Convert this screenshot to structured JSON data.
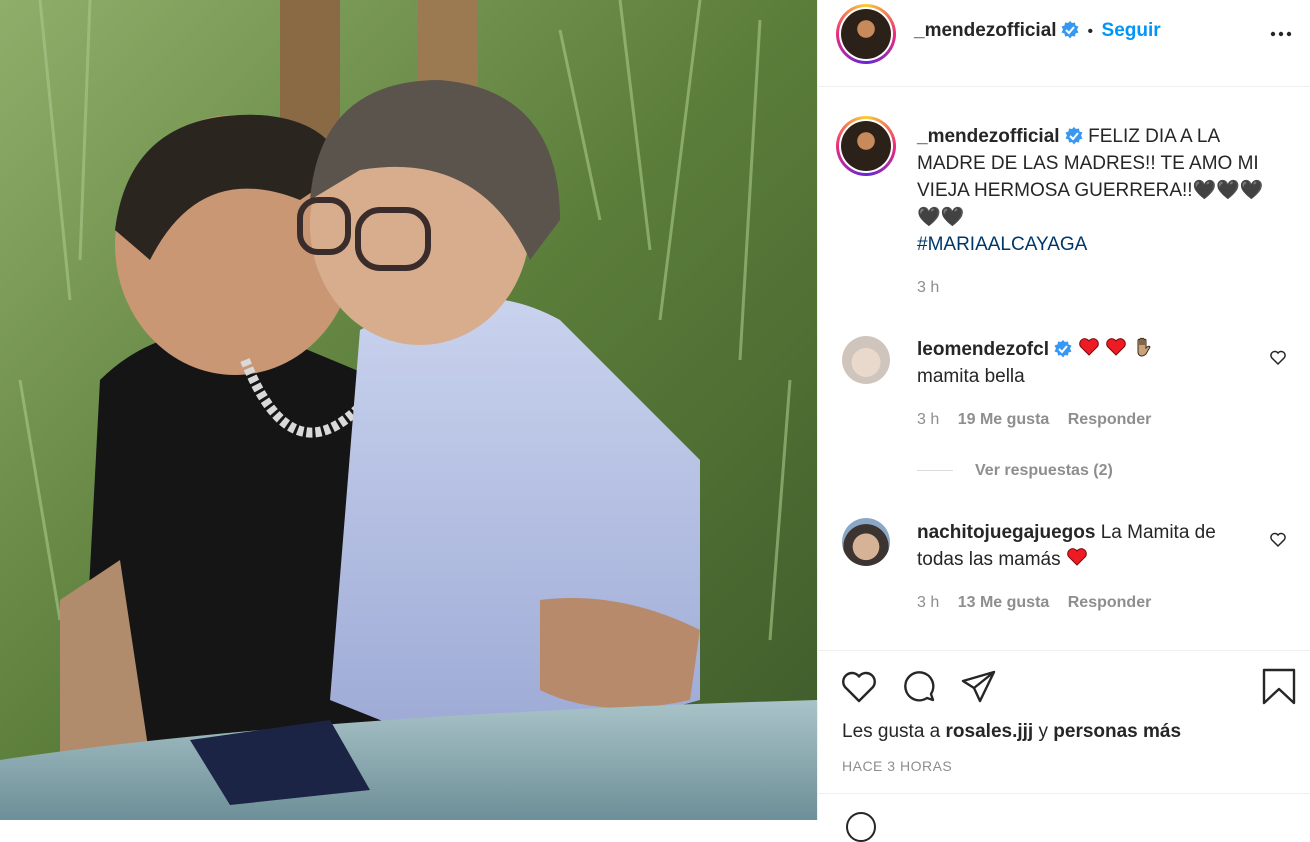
{
  "header": {
    "username": "_mendezofficial",
    "separator": "•",
    "follow_label": "Seguir"
  },
  "caption": {
    "username": "_mendezofficial",
    "text": "FELIZ DIA A LA MADRE DE LAS MADRES!! TE AMO MI VIEJA HERMOSA GUERRERA!!🖤🖤🖤🖤🖤",
    "hashtag": "#MARIAALCAYAGA",
    "time": "3 h"
  },
  "comments": [
    {
      "username": "leomendezofcl",
      "inline_text": "",
      "text": "mamita bella",
      "time": "3 h",
      "likes": "19 Me gusta",
      "reply_label": "Responder",
      "view_replies": "Ver respuestas (2)"
    },
    {
      "username": "nachitojuegajuegos",
      "inline_text": "La Mamita de todas las mamás",
      "time": "3 h",
      "likes": "13 Me gusta",
      "reply_label": "Responder"
    }
  ],
  "likes": {
    "prefix": "Les gusta a",
    "user": "rosales.jjj",
    "connector": "y",
    "suffix": "personas más"
  },
  "posted_ago": "HACE 3 HORAS",
  "colors": {
    "accent": "#0095f6",
    "verified": "#3897f0",
    "heart_red": "#ed4956",
    "hashtag": "#00376b"
  },
  "icons": [
    "more-options-icon",
    "verified-badge-icon",
    "heart-icon",
    "comment-icon",
    "share-icon",
    "bookmark-icon"
  ]
}
